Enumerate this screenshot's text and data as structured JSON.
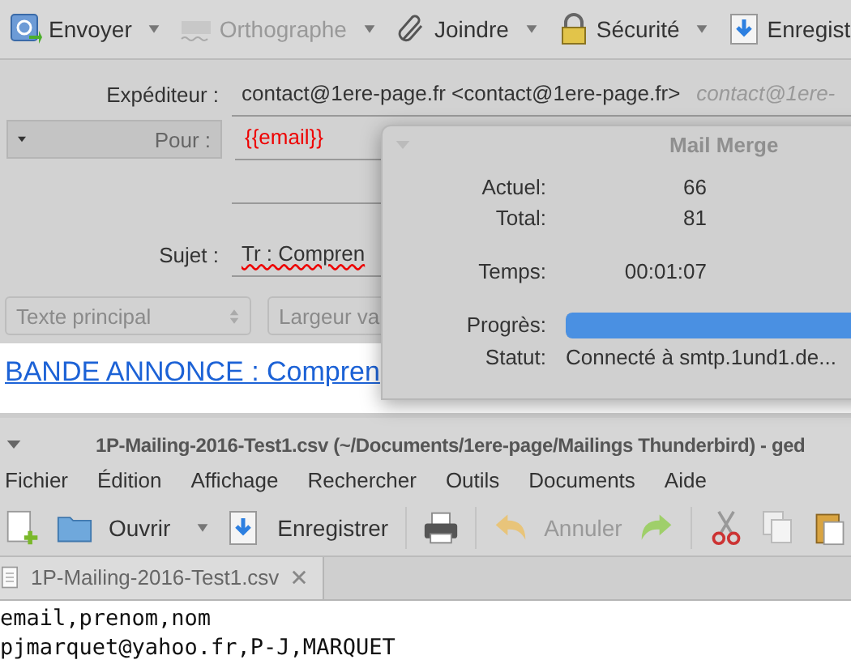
{
  "compose": {
    "toolbar": [
      {
        "label": "Envoyer",
        "disabled": false
      },
      {
        "label": "Orthographe",
        "disabled": true
      },
      {
        "label": "Joindre",
        "disabled": false
      },
      {
        "label": "Sécurité",
        "disabled": false
      },
      {
        "label": "Enregist",
        "disabled": false
      }
    ],
    "sender": {
      "label": "Expéditeur :",
      "value": "contact@1ere-page.fr <contact@1ere-page.fr>",
      "identity": "contact@1ere-"
    },
    "recipient": {
      "type_label": "Pour :",
      "value": "{{email}}"
    },
    "subject": {
      "label": "Sujet :",
      "value": "Tr : Compren"
    },
    "format": {
      "paragraph": "Texte principal",
      "width": "Largeur va"
    },
    "body": {
      "link": "BANDE ANNONCE : Compren"
    }
  },
  "dialog": {
    "title": "Mail Merge",
    "rows": [
      {
        "label": "Actuel:",
        "value": "66"
      },
      {
        "label": "Total:",
        "value": "81"
      },
      {
        "label": "Temps:",
        "value": "00:01:07"
      }
    ],
    "progress": {
      "label": "Progrès:",
      "level": 0.81
    },
    "status": {
      "label": "Statut:",
      "value": "Connecté à smtp.1und1.de..."
    }
  },
  "editor": {
    "title": "1P-Mailing-2016-Test1.csv (~/Documents/1ere-page/Mailings Thunderbird) - ged",
    "menu": [
      "Fichier",
      "Édition",
      "Affichage",
      "Rechercher",
      "Outils",
      "Documents",
      "Aide"
    ],
    "toolbar": [
      {
        "label": "Ouvrir",
        "disabled": false
      },
      {
        "label": "Enregistrer",
        "disabled": false
      },
      {
        "label": "Annuler",
        "disabled": true
      }
    ],
    "tabs": [
      {
        "label": "1P-Mailing-2016-Test1.csv",
        "selected": true
      }
    ],
    "lines": [
      "email,prenom,nom",
      "pjmarquet@yahoo.fr,P-J,MARQUET"
    ]
  }
}
